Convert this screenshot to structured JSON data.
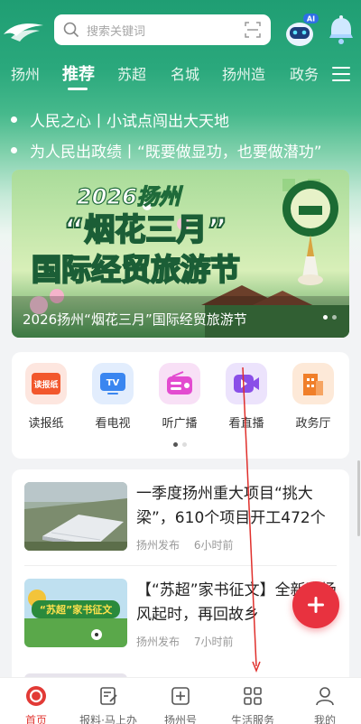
{
  "search": {
    "placeholder": "搜索关键词"
  },
  "header": {
    "robot_badge": "AI"
  },
  "nav": {
    "tabs": [
      "扬州",
      "推荐",
      "苏超",
      "名城",
      "扬州造",
      "政务"
    ],
    "active_index": 1
  },
  "ticker": [
    "人民之心丨小试点闯出大天地",
    "为人民出政绩丨“既要做显功，也要做潜功”"
  ],
  "banner": {
    "art_line1": "2026扬州",
    "art_line2": "“烟花三月”",
    "art_line3": "国际经贸旅游节",
    "caption": "2026扬州“烟花三月”国际经贸旅游节"
  },
  "quick": {
    "items": [
      {
        "label": "读报纸",
        "icon": "newspaper-icon",
        "icon_text": "读报纸",
        "color": "#f2572c"
      },
      {
        "label": "看电视",
        "icon": "tv-icon",
        "icon_text": "TV",
        "color": "#3a86f0"
      },
      {
        "label": "听广播",
        "icon": "radio-icon",
        "icon_text": "",
        "color": "#e34bd0"
      },
      {
        "label": "看直播",
        "icon": "live-icon",
        "icon_text": "",
        "color": "#8a4fe8"
      },
      {
        "label": "政务厅",
        "icon": "building-icon",
        "icon_text": "",
        "color": "#f07f2a"
      }
    ]
  },
  "news": [
    {
      "title": "一季度扬州重大项目“挑大梁”，610个项目开工472个",
      "source": "扬州发布",
      "time": "6小时前"
    },
    {
      "title": "【“苏超”家书征文】全新赛场风起时，再回故乡",
      "source": "扬州发布",
      "time": "7小时前",
      "thumb_text": "“苏超”家书征文"
    }
  ],
  "tabbar": {
    "items": [
      {
        "label": "首页",
        "icon": "home-icon"
      },
      {
        "label": "报料·马上办",
        "icon": "report-icon"
      },
      {
        "label": "扬州号",
        "icon": "plus-square-icon"
      },
      {
        "label": "生活服务",
        "icon": "grid-icon"
      },
      {
        "label": "我的",
        "icon": "user-icon"
      }
    ],
    "active_index": 0
  },
  "colors": {
    "brand_green": "#1f9e73",
    "accent_red": "#e23a36",
    "fab_red": "#e8323f"
  }
}
